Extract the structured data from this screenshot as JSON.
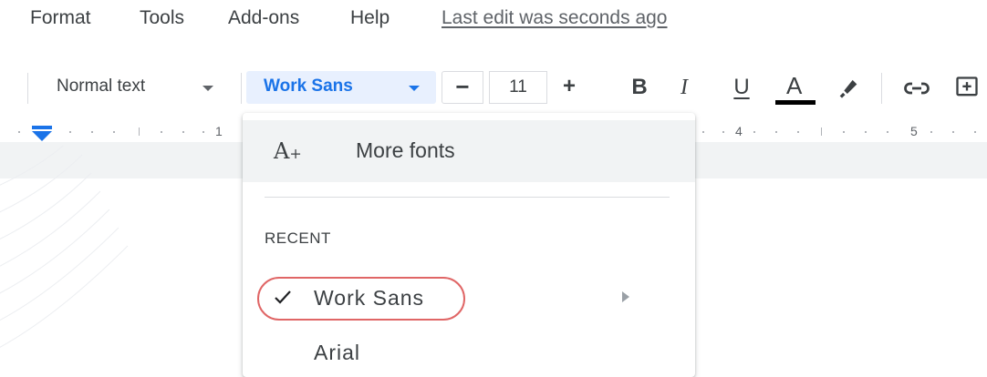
{
  "menubar": {
    "items": [
      "Format",
      "Tools",
      "Add-ons",
      "Help"
    ],
    "last_edit": "Last edit was seconds ago"
  },
  "toolbar": {
    "style_label": "Normal text",
    "font_label": "Work Sans",
    "font_size": "11",
    "minus_label": "−",
    "plus_label": "+",
    "bold_label": "B",
    "italic_label": "I",
    "underline_label": "U",
    "text_color_label": "A",
    "text_color": "#000000",
    "accent_color": "#1a73e8"
  },
  "ruler": {
    "numbers": [
      "1",
      "4",
      "5"
    ]
  },
  "font_menu": {
    "more_fonts_label": "More fonts",
    "more_fonts_icon": "font-add-icon",
    "section_recent": "RECENT",
    "recent_fonts": [
      "Work Sans",
      "Arial"
    ],
    "selected_font": "Work Sans",
    "highlight_color": "#e06666"
  }
}
